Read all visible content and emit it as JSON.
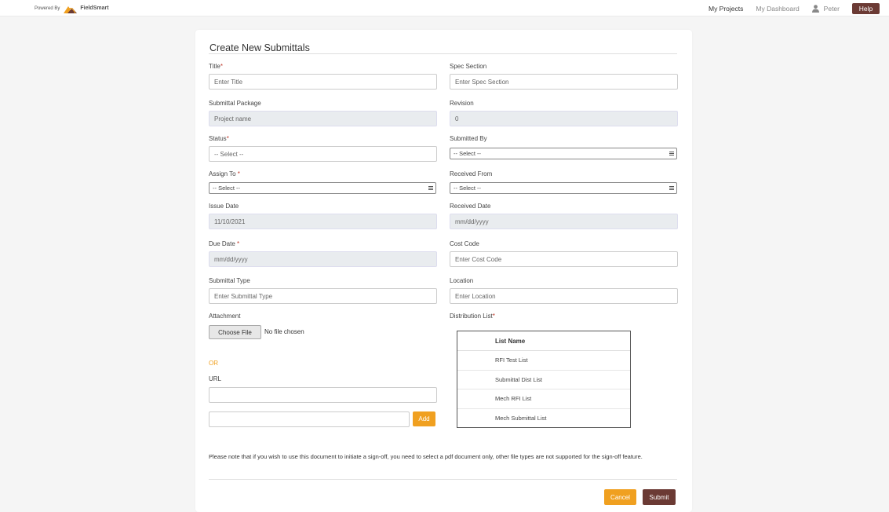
{
  "header": {
    "powered_by": "Powered By",
    "logo_text": "FieldSmart",
    "nav": {
      "my_projects": "My Projects",
      "my_dashboard": "My Dashboard",
      "user_name": "Peter",
      "help": "Help"
    },
    "brand_color": "#6b3a34",
    "accent_color": "#f0a020"
  },
  "form": {
    "title": "Create New Submittals",
    "required_mark": "*",
    "fields": {
      "title": {
        "label": "Title",
        "placeholder": "Enter Title"
      },
      "spec_section": {
        "label": "Spec Section",
        "placeholder": "Enter Spec Section"
      },
      "submittal_package": {
        "label": "Submittal Package",
        "value": "Project name"
      },
      "revision": {
        "label": "Revision",
        "value": "0"
      },
      "status": {
        "label": "Status",
        "value": "-- Select --"
      },
      "submitted_by": {
        "label": "Submitted By",
        "value": "-- Select --"
      },
      "assign_to": {
        "label": "Assign To ",
        "value": "-- Select --"
      },
      "received_from": {
        "label": "Received From",
        "value": "-- Select --"
      },
      "issue_date": {
        "label": "Issue Date",
        "value": "11/10/2021"
      },
      "received_date": {
        "label": "Received Date",
        "value": "mm/dd/yyyy"
      },
      "due_date": {
        "label": "Due Date ",
        "value": "mm/dd/yyyy"
      },
      "cost_code": {
        "label": "Cost Code",
        "placeholder": "Enter Cost Code"
      },
      "submittal_type": {
        "label": "Submittal Type",
        "placeholder": "Enter Submittal Type"
      },
      "location": {
        "label": "Location",
        "placeholder": "Enter Location"
      },
      "attachment": {
        "label": "Attachment",
        "button": "Choose File",
        "status": "No file chosen"
      },
      "distribution_list": {
        "label": "Distribution List"
      },
      "or_text": "OR",
      "url": {
        "label": "URL"
      },
      "add_button": "Add"
    },
    "distribution_table": {
      "header": "List Name",
      "rows": [
        "RFI Test List",
        "Submittal Dist List",
        "Mech RFI List",
        "Mech Submittal List"
      ]
    },
    "note": "Please note that if you wish to use this document to initiate a sign-off, you need to select a pdf document only, other file types are not supported for the sign-off feature.",
    "cancel": "Cancel",
    "submit": "Submit"
  }
}
